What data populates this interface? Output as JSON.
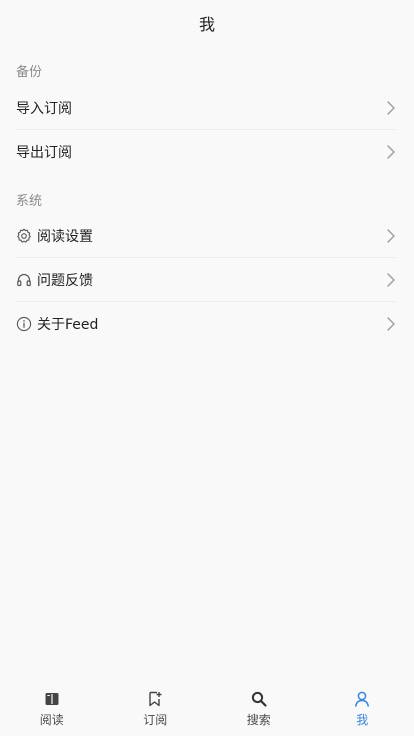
{
  "header": {
    "title": "我"
  },
  "sections": [
    {
      "title": "备份",
      "items": [
        {
          "label": "导入订阅"
        },
        {
          "label": "导出订阅"
        }
      ]
    },
    {
      "title": "系统",
      "items": [
        {
          "label": "阅读设置",
          "icon": "gear-icon"
        },
        {
          "label": "问题反馈",
          "icon": "headset-icon"
        },
        {
          "label": "关于Feed",
          "icon": "info-icon"
        }
      ]
    }
  ],
  "tabbar": {
    "tabs": [
      {
        "label": "阅读",
        "icon": "book-icon"
      },
      {
        "label": "订阅",
        "icon": "bookmark-add-icon"
      },
      {
        "label": "搜索",
        "icon": "search-icon"
      },
      {
        "label": "我",
        "icon": "user-icon",
        "active": true
      }
    ],
    "active_color": "#3a86d8"
  },
  "colors": {
    "background": "#f9f9f9",
    "section_title": "#8a8a8a",
    "divider": "#ececec",
    "text": "#222222"
  }
}
